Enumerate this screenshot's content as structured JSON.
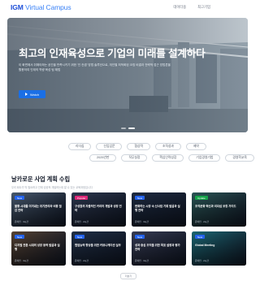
{
  "header": {
    "logo_brand": "IGM",
    "logo_suffix": "Virtual Campus",
    "nav": [
      "데이터용",
      "최고기업"
    ]
  },
  "hero": {
    "title": "최고의 인재육성으로 기업의 미래를 설계하다",
    "description": "이 화면에서 취해야하는 공간을 만족시키기 위한 '인 컨셉' 방법 솔루션으로, 개인별 최적화된 코칭 비결과 전략적 접근 방법론을 활용하여 인재의 역량 육성 팀 해법",
    "button_label": "Watch",
    "slides": 2,
    "active_slide": 2
  },
  "filters": {
    "row1": [
      "리더십",
      "신입입문",
      "협상력",
      "조직성과",
      "제약"
    ],
    "row2": [
      "2025년판",
      "직무실정",
      "핵심인력성장",
      "기업경영기법",
      "경영학교육"
    ]
  },
  "section": {
    "title": "날카로운 사업 계획 수립",
    "subtitle": "우리 회사가 딱 필요하고 인재 성공적 개발하는데 알 수 있는 교육과정입니다"
  },
  "cards": [
    {
      "badge": "New",
      "badge_color": "#2563eb",
      "title": "불황 시대를 이겨내는 위기관리와 비용 절감 전략",
      "meta": "온라인 · 3시간",
      "bg": "#4b5d72"
    },
    {
      "badge": "Popular",
      "badge_color": "#db2777",
      "title": "구성원의 자율적인 커리어 개발과 성장 전략",
      "meta": "온라인 · 2시간",
      "bg": "#2f3a52"
    },
    {
      "badge": "New",
      "badge_color": "#2563eb",
      "title": "변화하는 시장 속 신사업 기회 발굴과 실행 전략",
      "meta": "온라인 · 3시간",
      "bg": "#1f2d44"
    },
    {
      "badge": "Update",
      "badge_color": "#16a34a",
      "title": "조직문화 혁신과 리더십 코칭 가이드",
      "meta": "온라인 · 2시간",
      "bg": "#2d5a5a"
    },
    {
      "badge": "New",
      "badge_color": "#2563eb",
      "title": "디지털 전환 시대의 성장 동력 발굴과 실행",
      "meta": "온라인 · 3시간",
      "bg": "#5b4636"
    },
    {
      "badge": "New",
      "badge_color": "#2563eb",
      "title": "협업능력 향상을 위한 커뮤니케이션 실무",
      "meta": "온라인 · 2시간",
      "bg": "#22324a"
    },
    {
      "badge": "New",
      "badge_color": "#2563eb",
      "title": "성과 중심 조직을 위한 목표 설정과 평가 전략",
      "meta": "온라인 · 3시간",
      "bg": "#3a3f58"
    },
    {
      "badge": "New",
      "badge_color": "#2563eb",
      "title": "Global Meeting",
      "meta": "온라인 · 2시간",
      "bg": "#1d6d7a"
    }
  ],
  "more_label": "더보기"
}
